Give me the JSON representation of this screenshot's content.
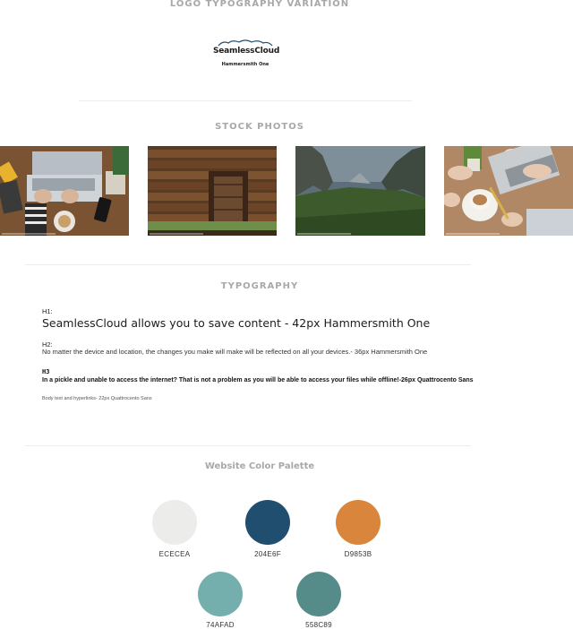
{
  "logo_section": {
    "title": "LOGO TYPOGRAPHY VARIATION",
    "logo_text": "SeamlessCloud",
    "logo_subtitle": "Hammersmith One"
  },
  "stock_section": {
    "title": "STOCK PHOTOS",
    "photos": [
      {
        "subject": "laptop-desk-photo"
      },
      {
        "subject": "log-cabin-door-photo"
      },
      {
        "subject": "mountain-valley-photo"
      },
      {
        "subject": "coffee-laptop-meeting-photo"
      }
    ]
  },
  "typography_section": {
    "title": "TYPOGRAPHY",
    "h1_label": "H1:",
    "h1_sample": "SeamlessCloud allows you to save content - 42px Hammersmith One",
    "h2_label": "H2:",
    "h2_sample": "No matter the device and location, the changes you make will make will be reflected on all your devices.- 36px Hammersmith One",
    "h3_label": "H3",
    "h3_sample": "In a pickle and unable to access the internet? That is not a problem as you will be able to access your files while offline!-26px Quattrocento Sans",
    "body_sample": "Body text  and hyperlinks- 22px Quattrocento Sans"
  },
  "palette_section": {
    "title": "Website Color Palette",
    "colors": [
      {
        "hex": "#ECECEA",
        "label": "ECECEA"
      },
      {
        "hex": "#204E6F",
        "label": "204E6F"
      },
      {
        "hex": "#D9853B",
        "label": "D9853B"
      },
      {
        "hex": "#74AFAD",
        "label": "74AFAD"
      },
      {
        "hex": "#558C89",
        "label": "558C89"
      }
    ]
  }
}
